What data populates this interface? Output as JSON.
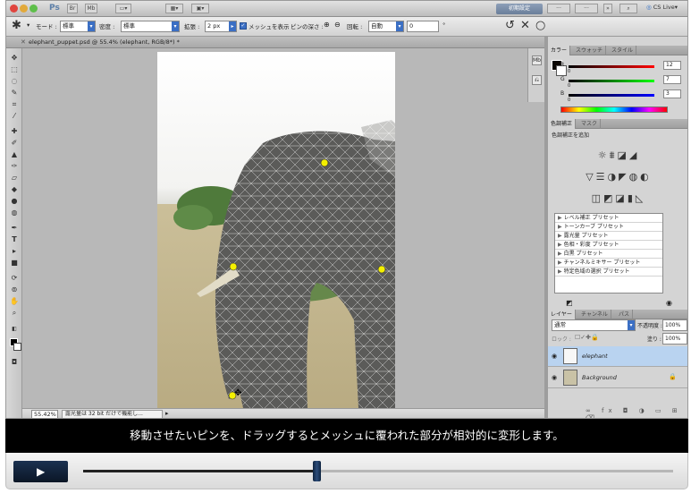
{
  "app": {
    "logo": "Ps",
    "workspace_label": "初期設定",
    "cs_live": "CS Live",
    "menu_icons": [
      "bridge-icon",
      "minibridge-icon",
      "screenmode-icon",
      "arrange-icon"
    ]
  },
  "options_bar": {
    "mode_label": "モード :",
    "mode_value": "標準",
    "density_label": "密度 :",
    "density_value": "標準",
    "expansion_label": "拡張 :",
    "expansion_value": "2 px",
    "show_mesh_label": "メッシュを表示",
    "show_mesh_checked": true,
    "pin_depth_label": "ピンの深さ :",
    "rotate_label": "回転 :",
    "rotate_value": "自動",
    "angle_value": "0",
    "degree_unit": "°"
  },
  "document": {
    "tab_title": "elephant_puppet.psd @ 55.4% (elephant, RGB/8*) *",
    "zoom": "55.42%",
    "status_text": "露光量は 32 bit だけで機能し..."
  },
  "color_panel": {
    "tabs": [
      "カラー",
      "スウォッチ",
      "スタイル"
    ],
    "r_label": "R",
    "g_label": "G",
    "b_label": "B",
    "r_value": "12",
    "g_value": "7",
    "b_value": "3",
    "r_zero": "0",
    "g_zero": "0",
    "b_zero": "0"
  },
  "adjustments_panel": {
    "tabs": [
      "色調補正",
      "マスク"
    ],
    "add_label": "色調補正を追加",
    "presets": [
      "レベル補正 プリセット",
      "トーンカーブ プリセット",
      "露光量 プリセット",
      "色相・彩度 プリセット",
      "白黒 プリセット",
      "チャンネルミキサー プリセット",
      "特定色域の選択 プリセット"
    ]
  },
  "layers_panel": {
    "tabs": [
      "レイヤー",
      "チャンネル",
      "パス"
    ],
    "blend_mode": "通常",
    "opacity_label": "不透明度 :",
    "opacity_value": "100%",
    "lock_label": "ロック :",
    "fill_label": "塗り :",
    "fill_value": "100%",
    "layers": [
      {
        "name": "elephant",
        "selected": true
      },
      {
        "name": "Background",
        "selected": false
      }
    ]
  },
  "caption": {
    "text": "移動させたいピンを、ドラッグするとメッシュに覆われた部分が相対的に変形します。"
  },
  "player": {
    "progress": 0.396
  },
  "colors": {
    "selection_blue": "#b9d3f0",
    "accent_blue": "#3b6fc4",
    "pin_yellow": "#f4f000"
  }
}
